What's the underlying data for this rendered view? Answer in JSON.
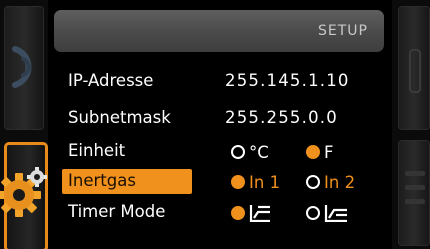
{
  "header": {
    "title": "SETUP"
  },
  "settings": [
    {
      "label": "IP-Adresse",
      "value": "255.145.1.10"
    },
    {
      "label": "Subnetmask",
      "value": "255.255.0.0"
    }
  ],
  "einheit": {
    "label": "Einheit",
    "options": [
      {
        "text": "°C",
        "selected": false
      },
      {
        "text": "F",
        "selected": true
      }
    ]
  },
  "inertgas": {
    "label": "Inertgas",
    "highlighted": true,
    "options": [
      {
        "text": "In 1",
        "selected": true
      },
      {
        "text": "In 2",
        "selected": false
      }
    ]
  },
  "timer_mode": {
    "label": "Timer Mode",
    "options": [
      {
        "icon": "timer-mode-rising-icon",
        "selected": true
      },
      {
        "icon": "timer-mode-step-icon",
        "selected": false
      }
    ]
  },
  "sidebar": {
    "left": [
      {
        "icon": "wave-icon",
        "active": false
      },
      {
        "icon": "gear-icon",
        "active": true
      }
    ],
    "right": [
      {
        "icon": "slot-icon",
        "active": false
      },
      {
        "icon": "bars-icon",
        "active": false
      }
    ]
  },
  "colors": {
    "accent": "#f0901d",
    "header_bg": "#555555",
    "background": "#000000",
    "text": "#ffffff"
  }
}
